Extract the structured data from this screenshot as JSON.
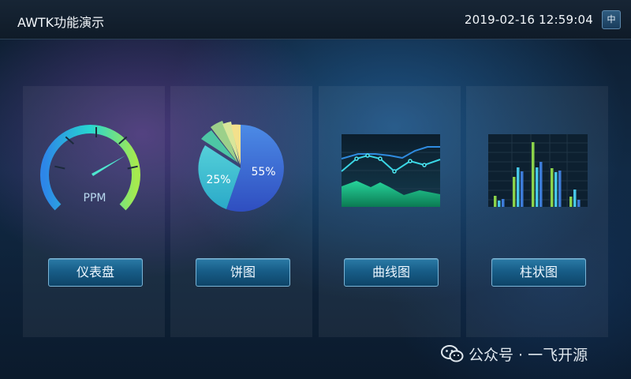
{
  "header": {
    "title": "AWTK功能演示",
    "datetime": "2019-02-16 12:59:04",
    "lang_button": "中"
  },
  "cards": [
    {
      "id": "gauge",
      "button_label": "仪表盘",
      "gauge_label": "PPM",
      "needle_fraction": 0.8
    },
    {
      "id": "pie",
      "button_label": "饼图",
      "slices": [
        {
          "value": 55,
          "label": "55%",
          "color": "#3e6ad6"
        },
        {
          "value": 25,
          "label": "25%",
          "color": "#3fc2cf"
        },
        {
          "value": 6,
          "label": "",
          "color": "#4dc7a5"
        },
        {
          "value": 5,
          "label": "",
          "color": "#9cd08a"
        },
        {
          "value": 4,
          "label": "",
          "color": "#d8e69a"
        },
        {
          "value": 5,
          "label": "",
          "color": "#f3e08c"
        }
      ]
    },
    {
      "id": "line",
      "button_label": "曲线图"
    },
    {
      "id": "bar",
      "button_label": "柱状图"
    }
  ],
  "colors": {
    "gauge_start": "#2d86e8",
    "gauge_mid": "#27d6d0",
    "gauge_end": "#a6ea4e",
    "line_series_1": "#2f8be0",
    "line_series_2": "#3ad7e6",
    "area_fill": "#17b57c",
    "bar_1": "#8bd24a",
    "bar_2": "#47c6e6",
    "bar_3": "#3d7bd8"
  },
  "watermark": {
    "icon": "wechat-icon",
    "text": "公众号 · 一飞开源"
  }
}
